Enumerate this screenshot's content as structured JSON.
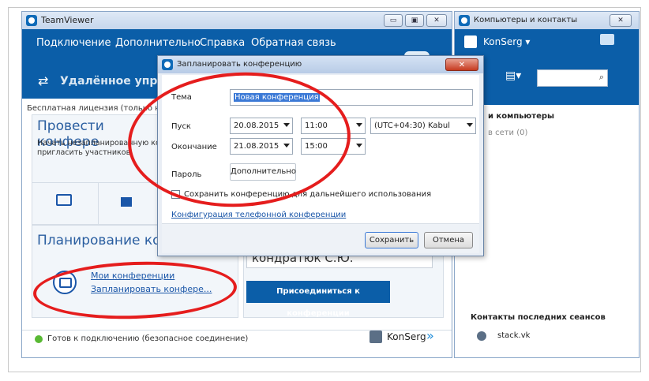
{
  "main_window": {
    "title": "TeamViewer",
    "menu": [
      "Подключение",
      "Дополнительно",
      "Справка",
      "Обратная связь"
    ],
    "remote_label": "Удалённое управл",
    "license_text": "Бесплатная лицензия (только не",
    "meeting_panel": {
      "title": "Провести конфере",
      "desc_line1": "Начать незапланированную ко",
      "desc_line2": "пригласить участников."
    },
    "planning_panel": {
      "title": "Планирование кон",
      "my_meetings": "Мои конференции",
      "schedule_meeting": "Запланировать конфере..."
    },
    "join_name": "кондратюк С.Ю.",
    "join_button": "Присоединиться к конференции",
    "status": "Готов к подключению (безопасное соединение)",
    "user": "KonSerg",
    "user_arrow": "»"
  },
  "contacts_window": {
    "title": "Компьютеры и контакты",
    "close": "✕",
    "user": "KonSerg ▾",
    "section_title": "и компьютеры",
    "online": "в сети (0)",
    "recent_title": "Контакты последних сеансов",
    "recent_contact": "stack.vk"
  },
  "dialog": {
    "title": "Запланировать конференцию",
    "close": "✕",
    "topic_label": "Тема",
    "topic_value": "Новая конференция",
    "start_label": "Пуск",
    "start_date": "20.08.2015",
    "start_time": "11:00",
    "timezone": "(UTC+04:30) Kabul",
    "end_label": "Окончание",
    "end_date": "21.08.2015",
    "end_time": "15:00",
    "password_label": "Пароль",
    "advanced_button": "Дополнительно",
    "save_checkbox": "Сохранить конференцию для дальнейшего использования",
    "phone_link": "Конфигурация телефонной конференции",
    "save_button": "Сохранить",
    "cancel_button": "Отмена"
  },
  "colors": {
    "brand_blue": "#0b5ea8",
    "highlight_red": "#e51d1d",
    "status_green": "#59b934"
  }
}
